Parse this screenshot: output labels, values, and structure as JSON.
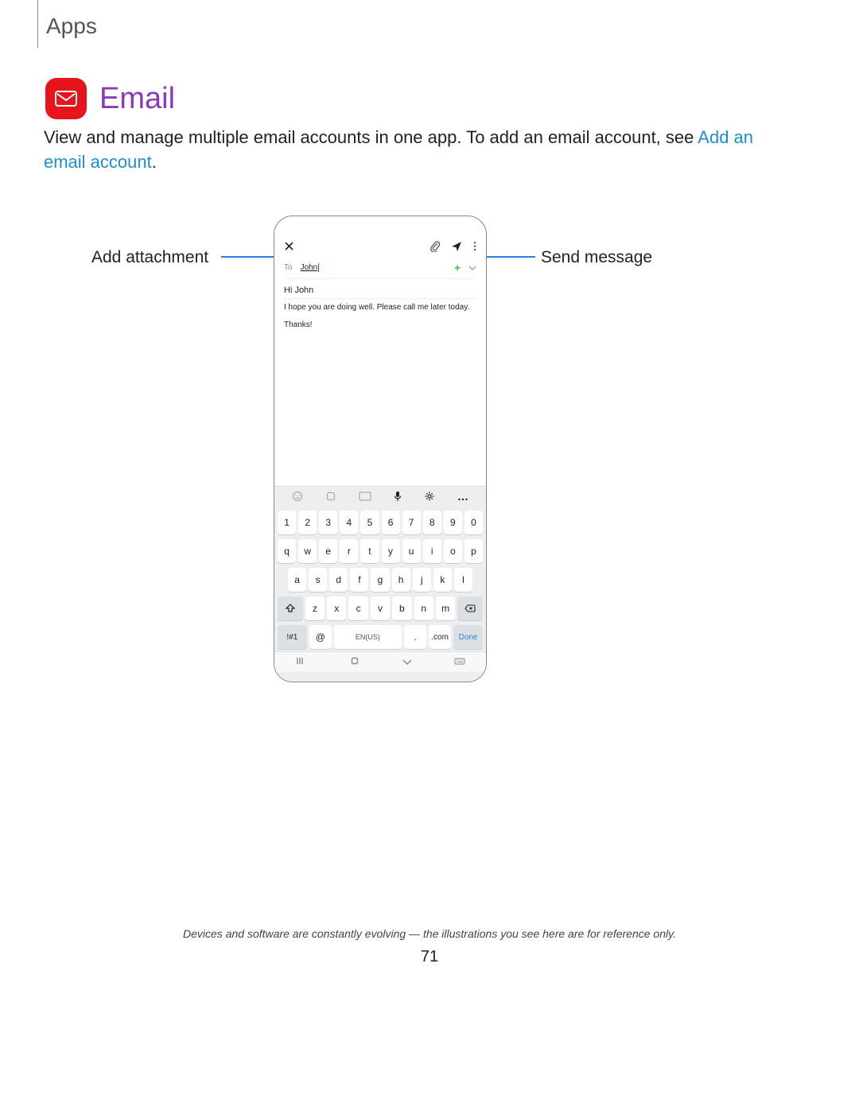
{
  "sectionTitle": "Apps",
  "heading": "Email",
  "introPart1": "View and manage multiple email accounts in one app. To add an email account, see ",
  "introLink": "Add an email account",
  "introPart2": ".",
  "calloutLeft": "Add attachment",
  "calloutRight": "Send message",
  "compose": {
    "toLabel": "To",
    "toValue": "John",
    "subject": "Hi John",
    "body1": "I hope you are doing well. Please call me later today.",
    "body2": "Thanks!"
  },
  "keyboard": {
    "row1": [
      "1",
      "2",
      "3",
      "4",
      "5",
      "6",
      "7",
      "8",
      "9",
      "0"
    ],
    "row2": [
      "q",
      "w",
      "e",
      "r",
      "t",
      "y",
      "u",
      "i",
      "o",
      "p"
    ],
    "row3": [
      "a",
      "s",
      "d",
      "f",
      "g",
      "h",
      "j",
      "k",
      "l"
    ],
    "row4": [
      "z",
      "x",
      "c",
      "v",
      "b",
      "n",
      "m"
    ],
    "sym": "!#1",
    "at": "@",
    "space": "EN(US)",
    "dot": ".",
    "com": ".com",
    "done": "Done"
  },
  "footerNote": "Devices and software are constantly evolving — the illustrations you see here are for reference only.",
  "pageNumber": "71"
}
